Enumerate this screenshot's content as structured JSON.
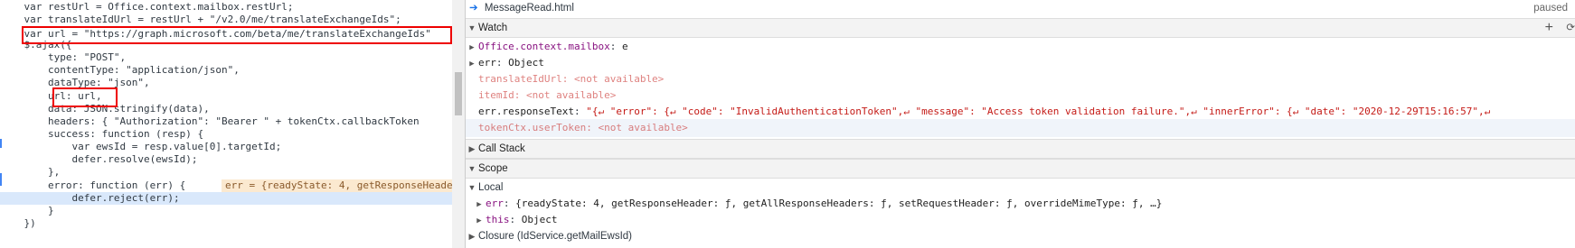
{
  "code": {
    "lines": [
      "    var restUrl = Office.context.mailbox.restUrl;",
      "    var translateIdUrl = restUrl + \"/v2.0/me/translateExchangeIds\";",
      "    var url = \"https://graph.microsoft.com/beta/me/translateExchangeIds\"",
      "    $.ajax({",
      "        type: \"POST\",",
      "        contentType: \"application/json\",",
      "        dataType: \"json\",",
      "        url: url,",
      "        data: JSON.stringify(data),",
      "        headers: { \"Authorization\": \"Bearer \" + tokenCtx.callbackToken",
      "        success: function (resp) {",
      "            var ewsId = resp.value[0].targetId;",
      "            defer.resolve(ewsId);",
      "        },",
      "        error: function (err) {",
      "            defer.reject(err);",
      "        }",
      "    })"
    ],
    "inline_value": "err = {readyState: 4, getResponseHeade"
  },
  "header": {
    "file_name": "MessageRead.html",
    "status": "paused"
  },
  "watch": {
    "title": "Watch",
    "add_icon": "+",
    "refresh_icon": "⟳",
    "items": [
      {
        "name": "Office.context.mailbox",
        "value": "e"
      },
      {
        "name": "err",
        "value": "Object"
      },
      {
        "name": "translateIdUrl",
        "value": "<not available>"
      },
      {
        "name": "itemId",
        "value": "<not available>"
      },
      {
        "name": "err.responseText",
        "value": "\"{↵  \"error\": {↵    \"code\": \"InvalidAuthenticationToken\",↵    \"message\": \"Access token validation failure.\",↵    \"innerError\": {↵      \"date\": \"2020-12-29T15:16:57\",↵"
      },
      {
        "name": "tokenCtx.userToken",
        "value": "<not available>"
      }
    ]
  },
  "callstack": {
    "title": "Call Stack"
  },
  "scope": {
    "title": "Scope",
    "local_title": "Local",
    "local_items": [
      {
        "name": "err",
        "value": "{readyState: 4, getResponseHeader: ƒ, getAllResponseHeaders: ƒ, setRequestHeader: ƒ, overrideMimeType: ƒ, …}"
      },
      {
        "name": "this",
        "value": "Object"
      }
    ],
    "closure": "Closure (IdService.getMailEwsId)"
  }
}
